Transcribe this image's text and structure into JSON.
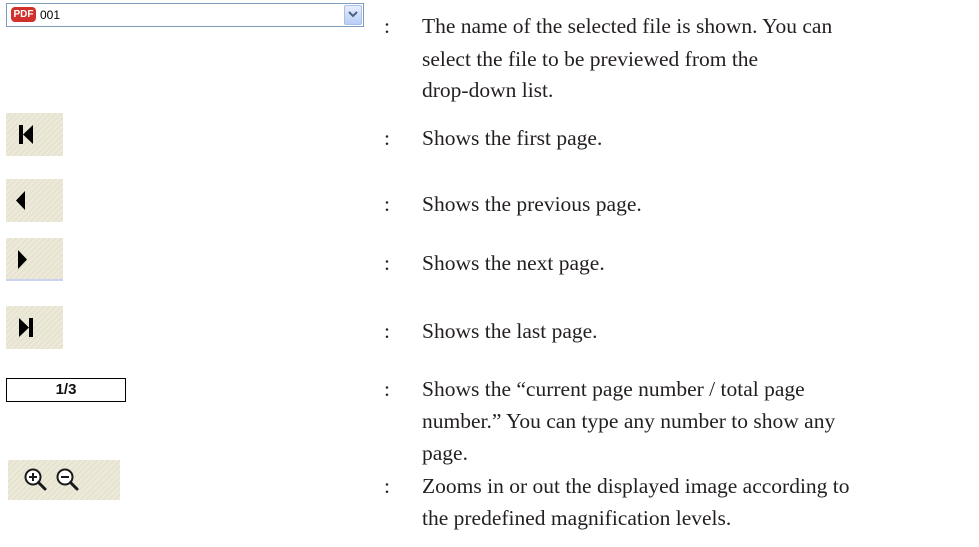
{
  "file_selector": {
    "badge": "PDF",
    "file_name": "001",
    "icon": "chevron-down-icon",
    "description_lines": [
      "The name of the selected file is shown. You can",
      "select the file to be previewed from the",
      "drop-down list."
    ]
  },
  "first_page": {
    "icon": "first-page-icon",
    "description": "Shows the first page."
  },
  "previous_page": {
    "icon": "previous-page-icon",
    "description": "Shows the previous page."
  },
  "next_page": {
    "icon": "next-page-icon",
    "description": "Shows the next page."
  },
  "last_page": {
    "icon": "last-page-icon",
    "description": "Shows the last page."
  },
  "page_number": {
    "value": "1/3",
    "description_lines": [
      "Shows the “current page number / total page",
      "number.” You can type any number to show any",
      "page."
    ]
  },
  "zoom": {
    "icons": [
      "zoom-in-icon",
      "zoom-out-icon"
    ],
    "description_lines": [
      "Zooms in or out the displayed image according to",
      "the predefined magnification levels."
    ]
  },
  "separator": ":",
  "colors": {
    "badge": "#d0312d",
    "button_face": "#ece9d8",
    "combo_border": "#7f9db9"
  }
}
